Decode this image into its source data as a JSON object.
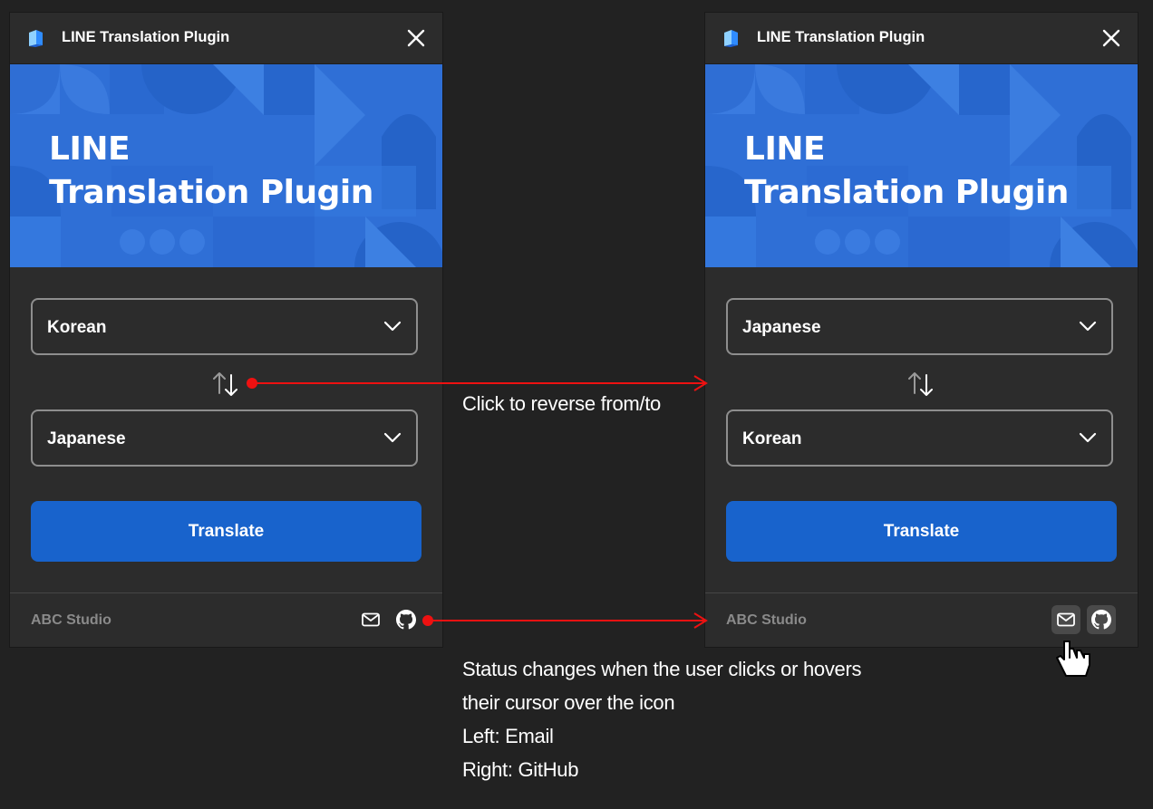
{
  "colors": {
    "background": "#222222",
    "panel": "#2c2c2c",
    "hero_blue": "#2f6fd6",
    "button_blue": "#1863cc",
    "annotation_red": "#ee1111"
  },
  "panels": [
    {
      "app_title": "LINE Translation Plugin",
      "hero_line1": "LINE",
      "hero_line2": "Translation Plugin",
      "from_language": "Korean",
      "to_language": "Japanese",
      "translate_label": "Translate",
      "footer_studio": "ABC Studio",
      "icons": [
        "mail-icon",
        "github-icon"
      ]
    },
    {
      "app_title": "LINE Translation Plugin",
      "hero_line1": "LINE",
      "hero_line2": "Translation Plugin",
      "from_language": "Japanese",
      "to_language": "Korean",
      "translate_label": "Translate",
      "footer_studio": "ABC Studio",
      "icons": [
        "mail-icon",
        "github-icon"
      ]
    }
  ],
  "annotations": {
    "reverse": "Click to reverse from/to",
    "status_lines": [
      "Status changes when the user clicks or hovers",
      "their cursor over the icon",
      "Left: Email",
      "Right: GitHub"
    ]
  }
}
